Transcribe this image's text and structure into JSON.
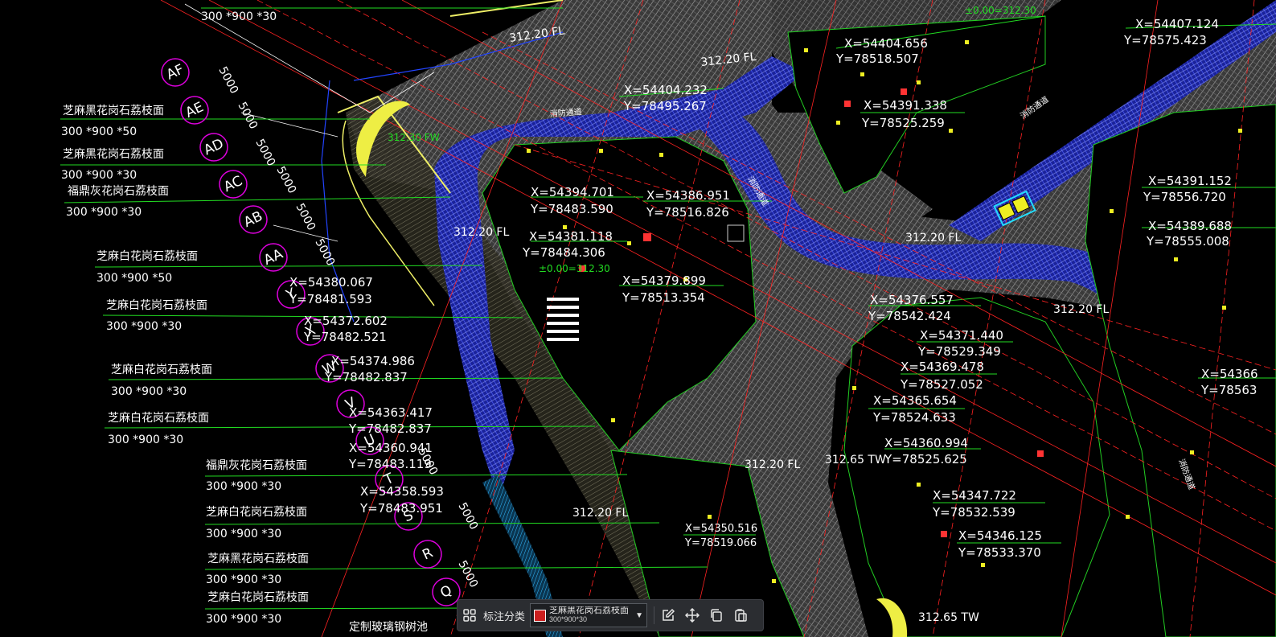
{
  "colors": {
    "background": "#000000",
    "hatch_blue": "#3344ff",
    "hatch_gray": "#9a9a9a",
    "grid_red": "#ff2222",
    "leader_green": "#22dd22",
    "bubble_magenta": "#dd00dd",
    "edge_yellow": "#eeee66",
    "selection_cyan": "#22ddff",
    "toolbar_bg": "#2b2d31",
    "swatch_red": "#cc1f1f"
  },
  "materials": [
    {
      "name": "",
      "size": "300 *900 *30"
    },
    {
      "name": "芝麻黑花岗石荔枝面",
      "size": "300 *900 *50"
    },
    {
      "name": "芝麻黑花岗石荔枝面",
      "size": "300 *900 *30"
    },
    {
      "name": "福鼎灰花岗石荔枝面",
      "size": "300 *900 *30"
    },
    {
      "name": "芝麻白花岗石荔枝面",
      "size": "300 *900 *50"
    },
    {
      "name": "芝麻白花岗石荔枝面",
      "size": "300 *900 *30"
    },
    {
      "name": "芝麻白花岗石荔枝面",
      "size": "300 *900 *30"
    },
    {
      "name": "芝麻白花岗石荔枝面",
      "size": "300 *900 *30"
    },
    {
      "name": "福鼎灰花岗石荔枝面",
      "size": "300 *900 *30"
    },
    {
      "name": "芝麻白花岗石荔枝面",
      "size": "300 *900 *30"
    },
    {
      "name": "芝麻黑花岗石荔枝面",
      "size": "300 *900 *30"
    },
    {
      "name": "芝麻白花岗石荔枝面",
      "size": "300 *900 *30"
    },
    {
      "name": "定制玻璃钢树池",
      "size": ""
    }
  ],
  "grid_bubbles": [
    "AF",
    "AE",
    "AD",
    "AC",
    "AB",
    "AA",
    "Y",
    "X",
    "W",
    "V",
    "U",
    "T",
    "S",
    "R",
    "Q"
  ],
  "dim_labels": [
    "5000",
    "5000",
    "5000",
    "5000",
    "5000",
    "5000",
    "5000",
    "5000",
    "5000"
  ],
  "coordinates": [
    {
      "x": "X=54404.656",
      "y": "Y=78518.507"
    },
    {
      "x": "X=54407.124",
      "y": "Y=78575.423"
    },
    {
      "x": "X=54404.232",
      "y": "Y=78495.267"
    },
    {
      "x": "X=54391.338",
      "y": "Y=78525.259"
    },
    {
      "x": "X=54394.701",
      "y": "Y=78483.590"
    },
    {
      "x": "X=54386.951",
      "y": "Y=78516.826"
    },
    {
      "x": "X=54391.152",
      "y": "Y=78556.720"
    },
    {
      "x": "X=54389.688",
      "y": "Y=78555.008"
    },
    {
      "x": "X=54381.118",
      "y": "Y=78484.306"
    },
    {
      "x": "X=54380.067",
      "y": "Y=78481.593"
    },
    {
      "x": "X=54379.899",
      "y": "Y=78513.354"
    },
    {
      "x": "X=54376.557",
      "y": "Y=78542.424"
    },
    {
      "x": "X=54372.602",
      "y": "Y=78482.521"
    },
    {
      "x": "X=54371.440",
      "y": "Y=78529.349"
    },
    {
      "x": "X=54369.478",
      "y": "Y=78527.052"
    },
    {
      "x": "X=54366",
      "y": "Y=78563"
    },
    {
      "x": "X=54374.986",
      "y": "Y=78482.837"
    },
    {
      "x": "X=54365.654",
      "y": "Y=78524.633"
    },
    {
      "x": "X=54363.417",
      "y": "Y=78482.837"
    },
    {
      "x": "X=54360.941",
      "y": "Y=78483.119"
    },
    {
      "x": "X=54360.994",
      "y": "Y=78525.625"
    },
    {
      "x": "X=54358.593",
      "y": "Y=78483.951"
    },
    {
      "x": "X=54347.722",
      "y": "Y=78532.539"
    },
    {
      "x": "X=54350.516",
      "y": "Y=78519.066"
    },
    {
      "x": "X=54346.125",
      "y": "Y=78533.370"
    }
  ],
  "elevations": [
    "312.20 FL",
    "312.20 FL",
    "312.20 FL",
    "312.20 FL",
    "312.20 FL",
    "312.20 FL",
    "312.20 FL",
    "312.65 TW",
    "312.65 TW",
    "±0.00=312.30",
    "±0.00=312.30",
    "312.30 FW"
  ],
  "road_labels": [
    "消防通道",
    "消防通道",
    "消防通道",
    "消防通道"
  ],
  "toolbar": {
    "label": "标注分类",
    "selected_main": "芝麻黑花岗石荔枝面",
    "selected_sub": "300*900*30"
  }
}
